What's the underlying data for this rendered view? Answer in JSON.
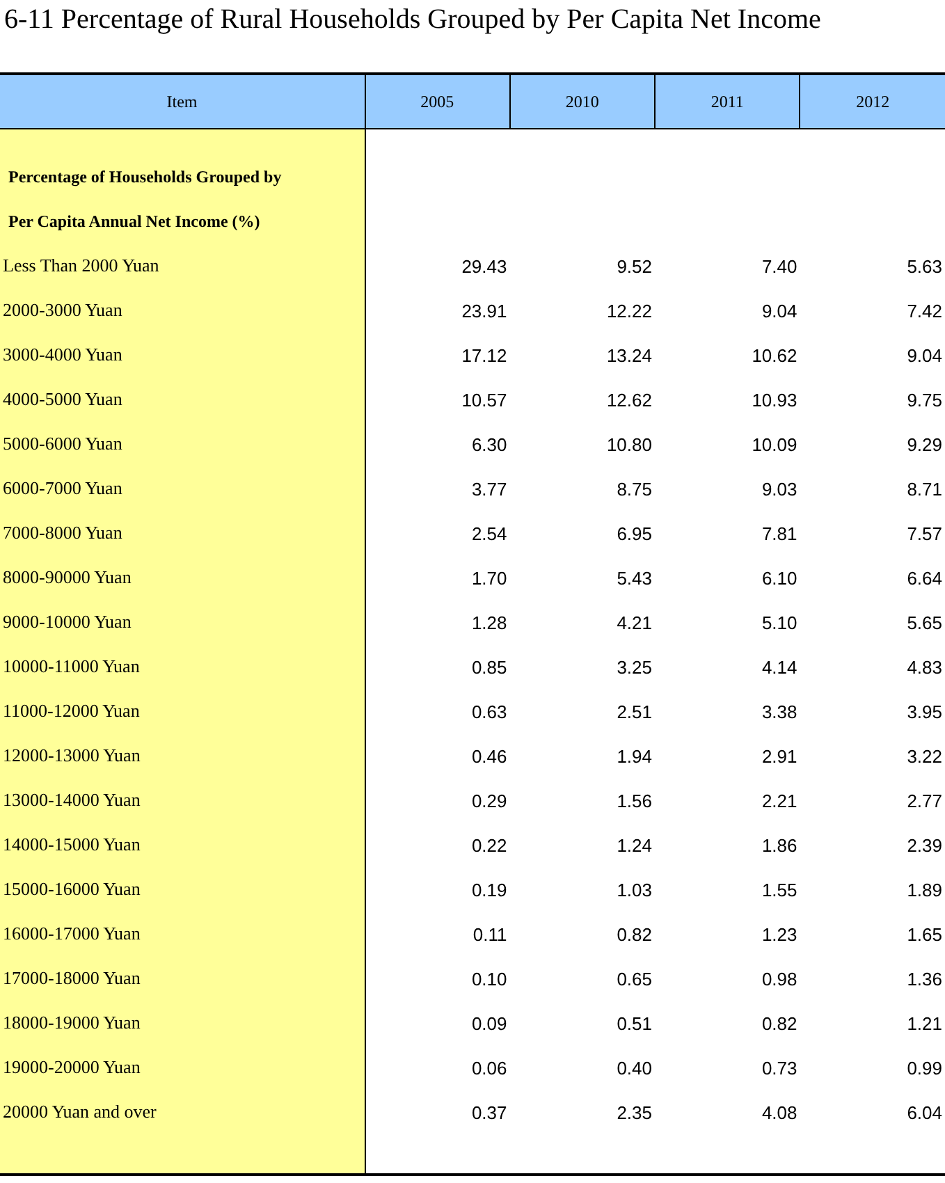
{
  "title": "6-11  Percentage of Rural Households Grouped by Per Capita Net Income",
  "table": {
    "columns": [
      "Item",
      "2005",
      "2010",
      "2011",
      "2012"
    ],
    "section_heading": [
      "Percentage of Households Grouped by",
      "Per Capita Annual Net Income (%)"
    ],
    "rows": [
      {
        "item": "Less Than 2000 Yuan",
        "values": [
          "29.43",
          "9.52",
          "7.40",
          "5.63"
        ]
      },
      {
        "item": "2000-3000 Yuan",
        "values": [
          "23.91",
          "12.22",
          "9.04",
          "7.42"
        ]
      },
      {
        "item": "3000-4000 Yuan",
        "values": [
          "17.12",
          "13.24",
          "10.62",
          "9.04"
        ]
      },
      {
        "item": "4000-5000 Yuan",
        "values": [
          "10.57",
          "12.62",
          "10.93",
          "9.75"
        ]
      },
      {
        "item": "5000-6000 Yuan",
        "values": [
          "6.30",
          "10.80",
          "10.09",
          "9.29"
        ]
      },
      {
        "item": "6000-7000 Yuan",
        "values": [
          "3.77",
          "8.75",
          "9.03",
          "8.71"
        ]
      },
      {
        "item": "7000-8000 Yuan",
        "values": [
          "2.54",
          "6.95",
          "7.81",
          "7.57"
        ]
      },
      {
        "item": "8000-90000 Yuan",
        "values": [
          "1.70",
          "5.43",
          "6.10",
          "6.64"
        ]
      },
      {
        "item": "9000-10000 Yuan",
        "values": [
          "1.28",
          "4.21",
          "5.10",
          "5.65"
        ]
      },
      {
        "item": "10000-11000 Yuan",
        "values": [
          "0.85",
          "3.25",
          "4.14",
          "4.83"
        ]
      },
      {
        "item": "11000-12000 Yuan",
        "values": [
          "0.63",
          "2.51",
          "3.38",
          "3.95"
        ]
      },
      {
        "item": "12000-13000 Yuan",
        "values": [
          "0.46",
          "1.94",
          "2.91",
          "3.22"
        ]
      },
      {
        "item": "13000-14000 Yuan",
        "values": [
          "0.29",
          "1.56",
          "2.21",
          "2.77"
        ]
      },
      {
        "item": "14000-15000 Yuan",
        "values": [
          "0.22",
          "1.24",
          "1.86",
          "2.39"
        ]
      },
      {
        "item": "15000-16000 Yuan",
        "values": [
          "0.19",
          "1.03",
          "1.55",
          "1.89"
        ]
      },
      {
        "item": "16000-17000 Yuan",
        "values": [
          "0.11",
          "0.82",
          "1.23",
          "1.65"
        ]
      },
      {
        "item": "17000-18000 Yuan",
        "values": [
          "0.10",
          "0.65",
          "0.98",
          "1.36"
        ]
      },
      {
        "item": "18000-19000 Yuan",
        "values": [
          "0.09",
          "0.51",
          "0.82",
          "1.21"
        ]
      },
      {
        "item": "19000-20000 Yuan",
        "values": [
          "0.06",
          "0.40",
          "0.73",
          "0.99"
        ]
      },
      {
        "item": "20000 Yuan and over",
        "values": [
          "0.37",
          "2.35",
          "4.08",
          "6.04"
        ]
      }
    ]
  }
}
